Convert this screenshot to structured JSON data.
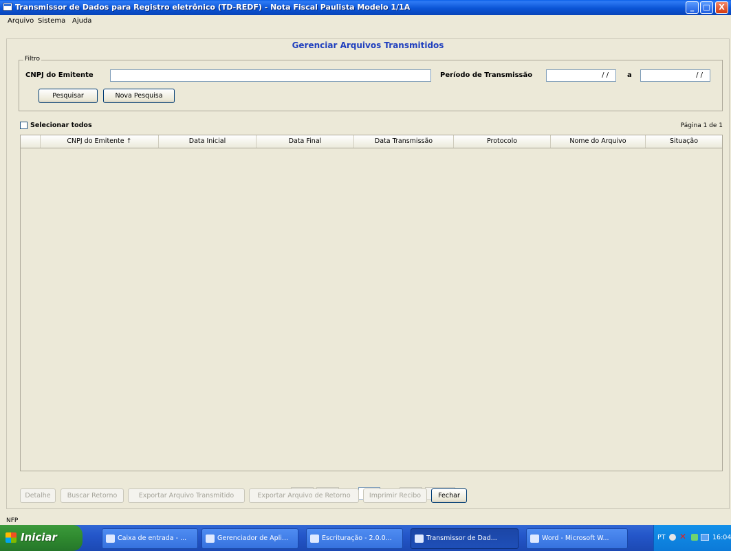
{
  "window": {
    "title": "Transmissor de Dados para Registro eletrônico (TD-REDF) - Nota Fiscal Paulista Modelo 1/1A",
    "buttons": {
      "minimize": "_",
      "maximize": "□",
      "close": "X"
    }
  },
  "menu": [
    "Arquivo",
    "Sistema",
    "Ajuda"
  ],
  "panel": {
    "title": "Gerenciar Arquivos Transmitidos"
  },
  "filter": {
    "legend": "Filtro",
    "cnpj_label": "CNPJ do Emitente",
    "cnpj_value": "",
    "period_label": "Período de Transmissão",
    "date_from": "/ /",
    "separator": "a",
    "date_to": "/ /",
    "search_button": "Pesquisar",
    "new_search_button": "Nova Pesquisa"
  },
  "table": {
    "select_all_label": "Selecionar todos",
    "page_info": "Página 1 de 1",
    "columns": [
      "CNPJ do Emitente ↑",
      "Data Inicial",
      "Data Final",
      "Data Transmissão",
      "Protocolo",
      "Nome do Arquivo",
      "Situação"
    ],
    "rows": []
  },
  "pagination": {
    "first": "|<",
    "prev": "<",
    "page": "1",
    "next": ">",
    "last": ">|"
  },
  "actions": {
    "detail": "Detalhe",
    "fetch_return": "Buscar Retorno",
    "export_transmitted": "Exportar Arquivo Transmitido",
    "export_return": "Exportar Arquivo de Retorno",
    "print_receipt": "Imprimir Recibo",
    "close": "Fechar"
  },
  "status_bar": {
    "text": "NFP"
  },
  "taskbar": {
    "start": "Iniciar",
    "tasks": [
      "Caixa de entrada - ...",
      "Gerenciador de Apli...",
      "Escrituração - 2.0.0...",
      "Transmissor de Dad...",
      "Word - Microsoft W..."
    ],
    "tray_lang": "PT",
    "clock": "16:04"
  },
  "colors": {
    "titlebar": "#0b55d6",
    "panel_title": "#1f3fbe",
    "background": "#ece9d8",
    "taskbar": "#2456c9",
    "start": "#2f8a2f"
  }
}
